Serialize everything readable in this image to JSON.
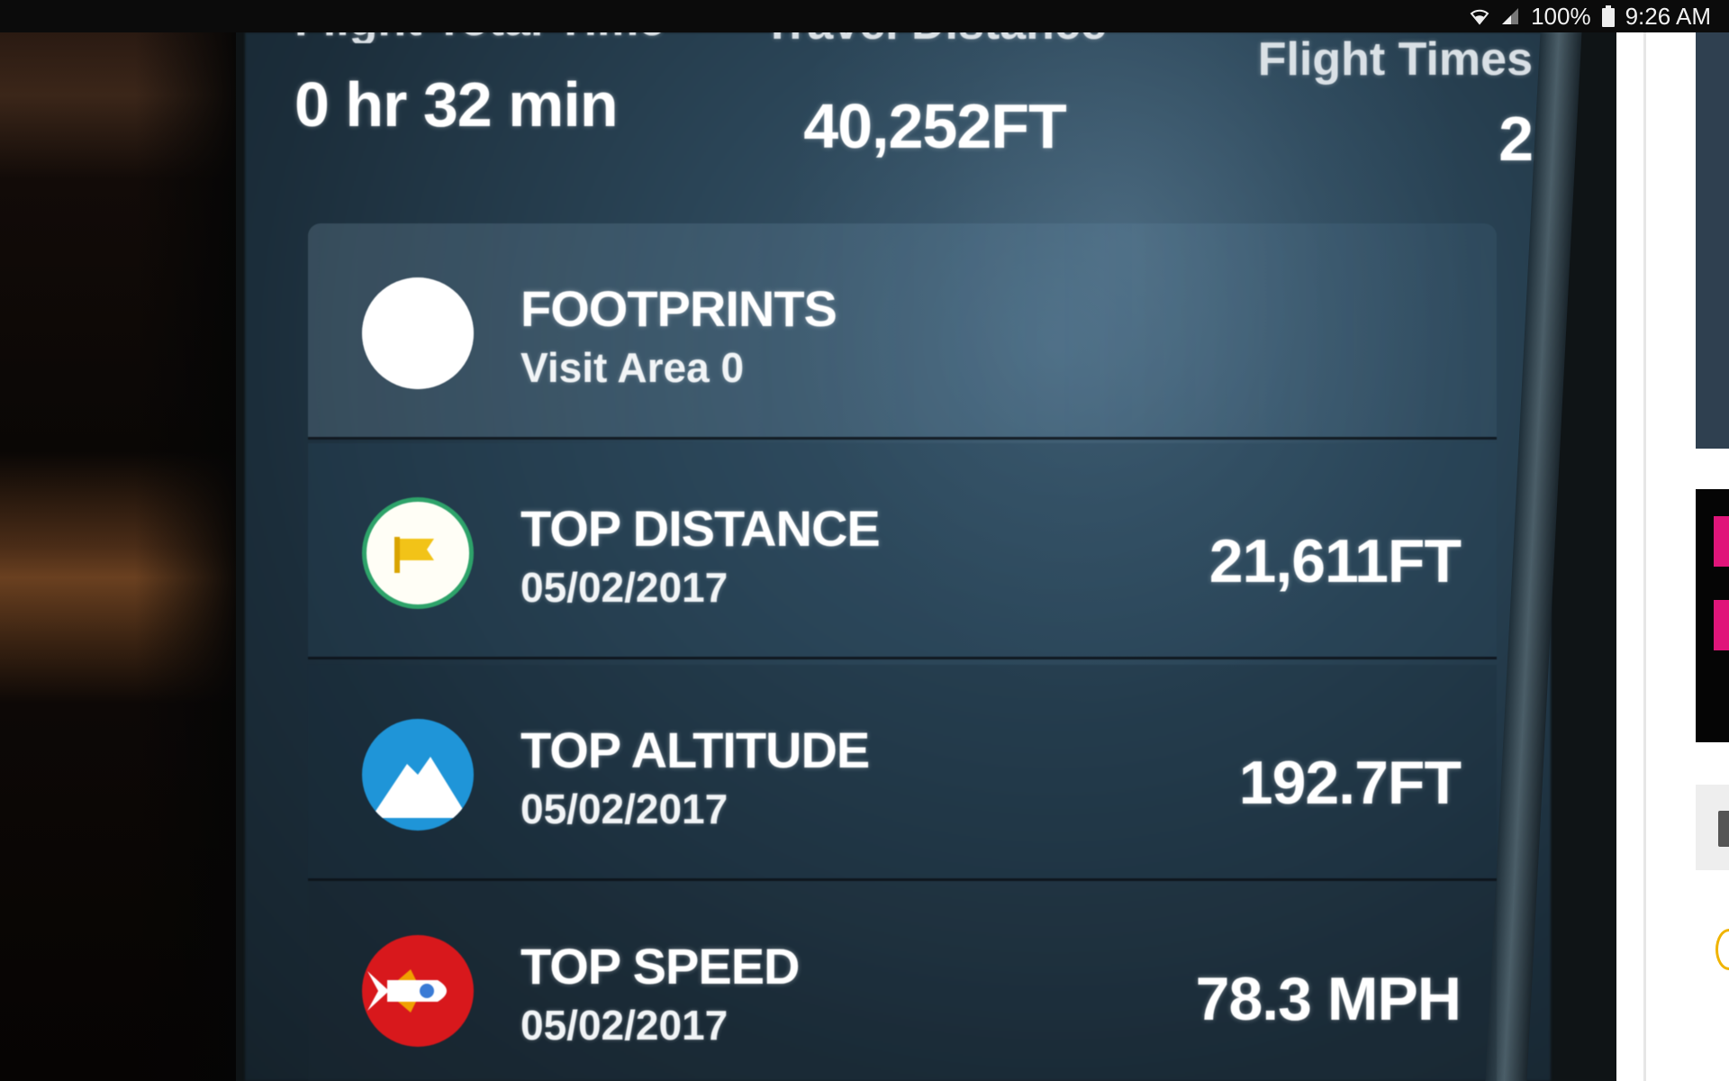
{
  "status_bar": {
    "battery": "100%",
    "time": "9:26 AM",
    "icons": [
      "wifi-icon",
      "signal-icon",
      "battery-icon"
    ]
  },
  "stats": {
    "flight_time": {
      "label": "Flight Total Time",
      "value": "0 hr 32 min"
    },
    "travel_distance": {
      "label": "Travel Distance",
      "value": "40,252FT"
    },
    "flight_times": {
      "label": "Flight Times",
      "value": "2"
    }
  },
  "records": [
    {
      "icon": "footprints-icon",
      "title": "FOOTPRINTS",
      "subtitle": "Visit Area 0",
      "value": ""
    },
    {
      "icon": "flag-icon",
      "title": "TOP DISTANCE",
      "subtitle": "05/02/2017",
      "value": "21,611FT"
    },
    {
      "icon": "mountain-icon",
      "title": "TOP ALTITUDE",
      "subtitle": "05/02/2017",
      "value": "192.7FT"
    },
    {
      "icon": "rocket-icon",
      "title": "TOP SPEED",
      "subtitle": "05/02/2017",
      "value": "78.3 MPH"
    }
  ],
  "colors": {
    "flag_ring": "#2ea36a",
    "mountain_bg": "#1f95d8",
    "rocket_bg": "#d8181c",
    "screen_bg": "#2a4456"
  }
}
